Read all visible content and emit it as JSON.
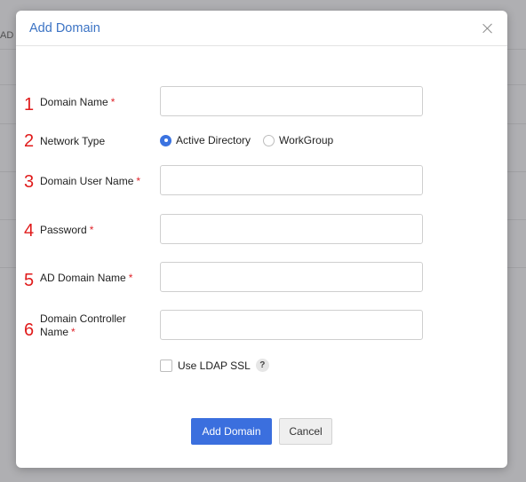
{
  "background": {
    "fragment_text": "AD C"
  },
  "modal": {
    "title": "Add Domain",
    "fields": [
      {
        "number": "1",
        "label": "Domain Name",
        "required": "*",
        "value": ""
      },
      {
        "number": "2",
        "label": "Network Type"
      },
      {
        "number": "3",
        "label": "Domain User Name",
        "required": "*",
        "value": ""
      },
      {
        "number": "4",
        "label": "Password",
        "required": "*",
        "value": ""
      },
      {
        "number": "5",
        "label": "AD Domain Name",
        "required": "*",
        "value": ""
      },
      {
        "number": "6",
        "label_line1": "Domain Controller",
        "label_line2": "Name",
        "required": "*",
        "value": ""
      }
    ],
    "network_type": {
      "options": [
        "Active Directory",
        "WorkGroup"
      ],
      "selected": "Active Directory"
    },
    "ldap": {
      "label": "Use LDAP SSL",
      "checked": false,
      "help": "?"
    },
    "buttons": {
      "submit": "Add Domain",
      "cancel": "Cancel"
    }
  },
  "colors": {
    "accent": "#3b6fde",
    "title": "#3b73c4",
    "annotation": "#e01b1b",
    "required": "#e0242b"
  },
  "icons": [
    "close-icon",
    "help-icon",
    "radio-checked-icon",
    "radio-unchecked-icon"
  ]
}
